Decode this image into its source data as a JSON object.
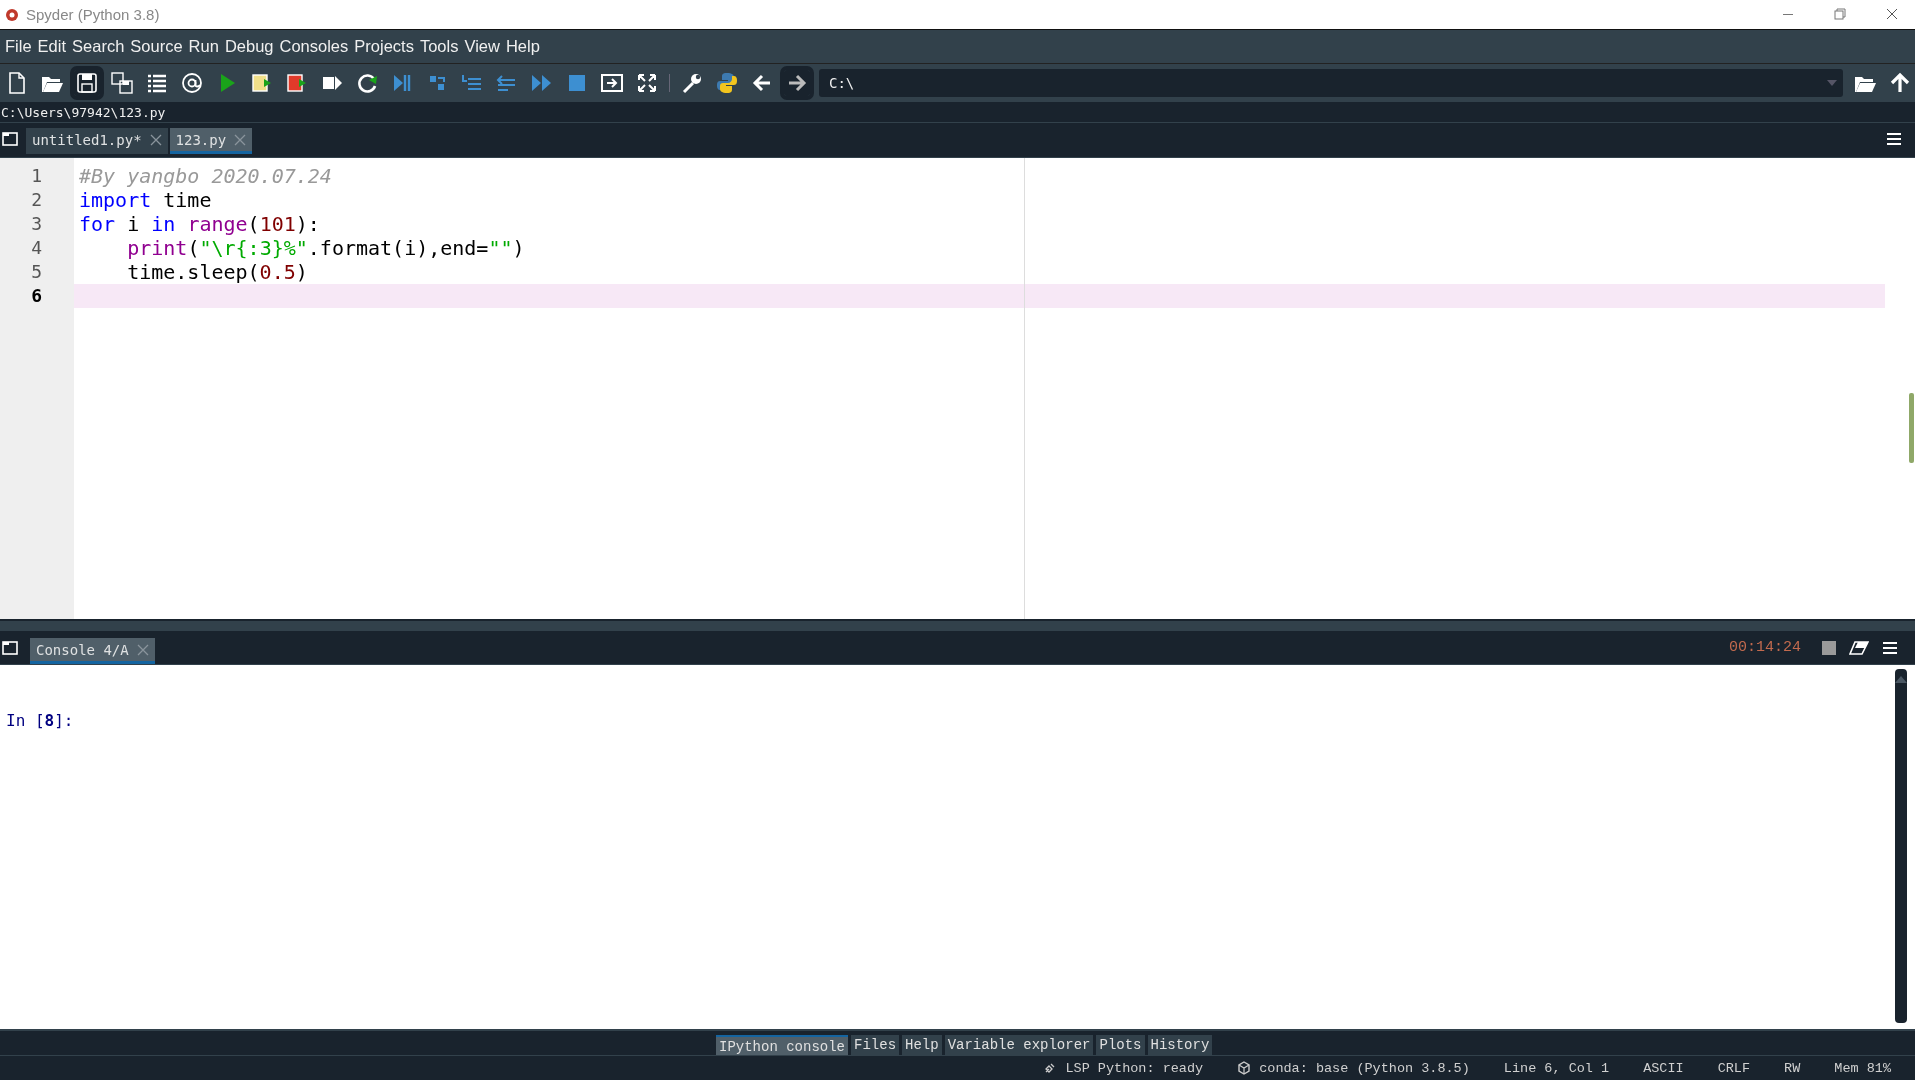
{
  "window": {
    "title": "Spyder (Python 3.8)"
  },
  "menu": [
    "File",
    "Edit",
    "Search",
    "Source",
    "Run",
    "Debug",
    "Consoles",
    "Projects",
    "Tools",
    "View",
    "Help"
  ],
  "toolbar": {
    "path_field": {
      "value": "C:\\"
    }
  },
  "file_path": "C:\\Users\\97942\\123.py",
  "editor_tabs": [
    {
      "label": "untitled1.py*",
      "selected": false
    },
    {
      "label": "123.py",
      "selected": true
    }
  ],
  "editor": {
    "lines": [
      {
        "number": "1",
        "current": false,
        "tokens": [
          {
            "kind": "comment",
            "text": "#By yangbo 2020.07.24"
          }
        ]
      },
      {
        "number": "2",
        "current": false,
        "tokens": [
          {
            "kind": "keyword",
            "text": "import"
          },
          {
            "kind": "plain",
            "text": " time"
          }
        ]
      },
      {
        "number": "3",
        "current": false,
        "tokens": [
          {
            "kind": "keyword",
            "text": "for"
          },
          {
            "kind": "plain",
            "text": " i "
          },
          {
            "kind": "keyword",
            "text": "in"
          },
          {
            "kind": "builtin",
            "text": "range",
            "space_before": true
          },
          {
            "kind": "plain",
            "text": "("
          },
          {
            "kind": "number",
            "text": "101"
          },
          {
            "kind": "plain",
            "text": "):"
          }
        ]
      },
      {
        "number": "4",
        "current": false,
        "indented": true,
        "tokens": [
          {
            "kind": "builtin",
            "text": "print"
          },
          {
            "kind": "plain",
            "text": "("
          },
          {
            "kind": "string",
            "text": "\"\\r{:3}%\""
          },
          {
            "kind": "plain",
            "text": ".format(i),end="
          },
          {
            "kind": "string",
            "text": "\"\""
          },
          {
            "kind": "plain",
            "text": ")"
          }
        ]
      },
      {
        "number": "5",
        "current": false,
        "indented": true,
        "tokens": [
          {
            "kind": "plain",
            "text": "time.sleep("
          },
          {
            "kind": "number",
            "text": "0.5"
          },
          {
            "kind": "plain",
            "text": ")"
          }
        ]
      },
      {
        "number": "6",
        "current": true
      }
    ]
  },
  "console_tabs": [
    {
      "label": "Console 4/A",
      "selected": true
    }
  ],
  "console": {
    "timer": "00:14:24",
    "prompt_prefix": "In [",
    "prompt_number": "8",
    "prompt_suffix": "]:"
  },
  "pane_tabs": [
    {
      "label": "IPython console",
      "selected": true
    },
    {
      "label": "Files",
      "selected": false
    },
    {
      "label": "Help",
      "selected": false
    },
    {
      "label": "Variable explorer",
      "selected": false
    },
    {
      "label": "Plots",
      "selected": false
    },
    {
      "label": "History",
      "selected": false
    }
  ],
  "status_bar": [
    {
      "kind": "lsp",
      "text": "LSP Python: ready"
    },
    {
      "kind": "conda",
      "text": "conda: base (Python 3.8.5)"
    },
    {
      "kind": "plain",
      "text": "Line 6, Col 1"
    },
    {
      "kind": "plain",
      "text": "ASCII"
    },
    {
      "kind": "plain",
      "text": "CRLF"
    },
    {
      "kind": "plain",
      "text": "RW"
    },
    {
      "kind": "plain",
      "text": "Mem 81%"
    }
  ]
}
